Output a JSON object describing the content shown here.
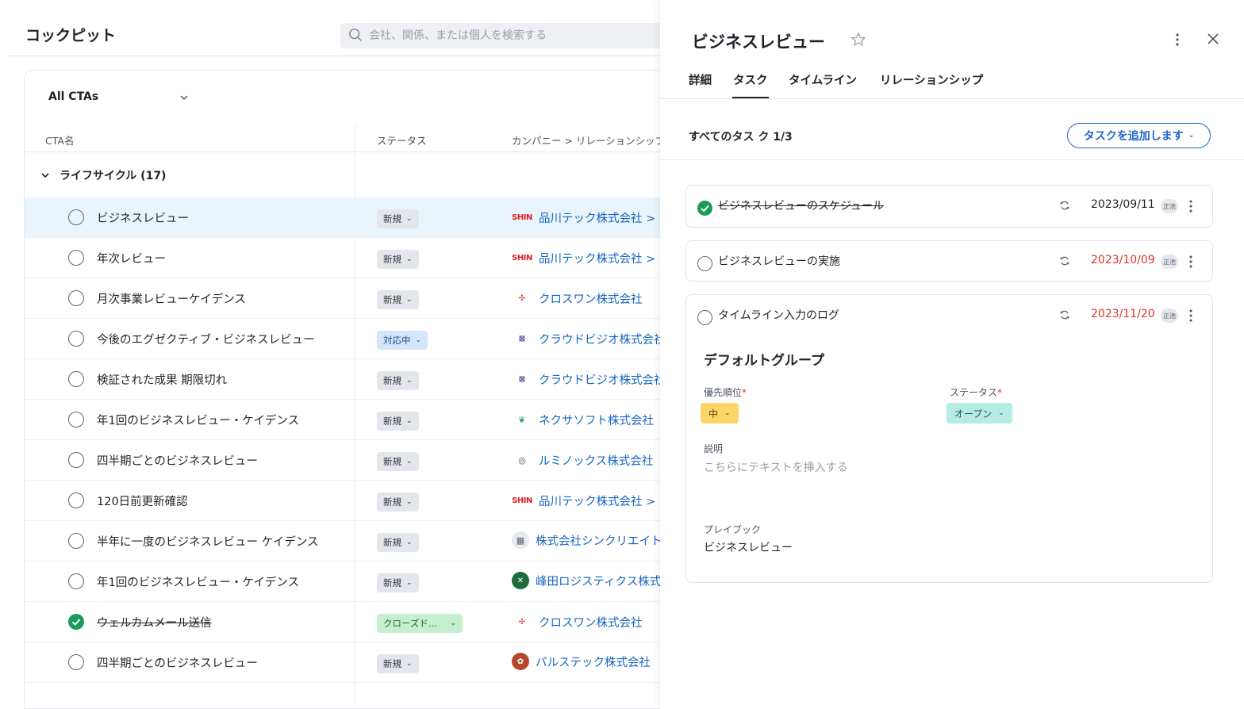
{
  "app": {
    "title": "コックピット"
  },
  "search": {
    "placeholder": "会社、関係、または個人を検索する"
  },
  "view": {
    "label": "All CTAs"
  },
  "columns": {
    "name": "CTA名",
    "status": "ステータス",
    "company": "カンパニー > リレーションシップ"
  },
  "group": {
    "label": "ライフサイクル (17)"
  },
  "rows": [
    {
      "name": "ビジネスレビュー",
      "done": false,
      "status": "新規",
      "status_kind": "new",
      "logo": "SHIN",
      "logo_kind": "shin",
      "company": "品川テック株式会社 >"
    },
    {
      "name": "年次レビュー",
      "done": false,
      "status": "新規",
      "status_kind": "new",
      "logo": "SHIN",
      "logo_kind": "shin",
      "company": "品川テック株式会社 >"
    },
    {
      "name": "月次事業レビューケイデンス",
      "done": false,
      "status": "新規",
      "status_kind": "new",
      "logo": "✣",
      "logo_kind": "cross",
      "company": "クロスワン株式会社"
    },
    {
      "name": "今後のエグゼクティブ・ビジネスレビュー",
      "done": false,
      "status": "対応中",
      "status_kind": "prog",
      "logo": "⊠",
      "logo_kind": "cloud",
      "company": "クラウドビジオ株式会社"
    },
    {
      "name": "検証された成果 期限切れ",
      "done": false,
      "status": "新規",
      "status_kind": "new",
      "logo": "⊠",
      "logo_kind": "cloud",
      "company": "クラウドビジオ株式会社"
    },
    {
      "name": "年1回のビジネスレビュー・ケイデンス",
      "done": false,
      "status": "新規",
      "status_kind": "new",
      "logo": "❦",
      "logo_kind": "nexa",
      "company": "ネクサソフト株式会社"
    },
    {
      "name": "四半期ごとのビジネスレビュー",
      "done": false,
      "status": "新規",
      "status_kind": "new",
      "logo": "◎",
      "logo_kind": "lumi",
      "company": "ルミノックス株式会社"
    },
    {
      "name": "120日前更新確認",
      "done": false,
      "status": "新規",
      "status_kind": "new",
      "logo": "SHIN",
      "logo_kind": "shin",
      "company": "品川テック株式会社 >"
    },
    {
      "name": "半年に一度のビジネスレビュー ケイデンス",
      "done": false,
      "status": "新規",
      "status_kind": "new",
      "logo": "▦",
      "logo_kind": "bldg",
      "company": "株式会社シンクリエイト"
    },
    {
      "name": "年1回のビジネスレビュー・ケイデンス",
      "done": false,
      "status": "新規",
      "status_kind": "new",
      "logo": "✕",
      "logo_kind": "mine",
      "company": "峰田ロジスティクス株式会社"
    },
    {
      "name": "ウェルカムメール送信",
      "done": true,
      "status": "クローズド...",
      "status_kind": "closed",
      "logo": "✣",
      "logo_kind": "cross",
      "company": "クロスワン株式会社"
    },
    {
      "name": "四半期ごとのビジネスレビュー",
      "done": false,
      "status": "新規",
      "status_kind": "new",
      "logo": "✿",
      "logo_kind": "puls",
      "company": "パルステック株式会社"
    }
  ],
  "panel": {
    "title": "ビジネスレビュー",
    "tabs": [
      "詳細",
      "タスク",
      "タイムライン",
      "リレーションシップ"
    ],
    "active_tab": "タスク",
    "tasks_header": "すべてのタス ク 1/3",
    "add_task_label": "タスクを追加します",
    "tasks": [
      {
        "name": "ビジネスレビューのスケジュール",
        "done": true,
        "date": "2023/09/11",
        "overdue": false,
        "owner": "正池"
      },
      {
        "name": "ビジネスレビューの実施",
        "done": false,
        "date": "2023/10/09",
        "overdue": true,
        "owner": "正池"
      },
      {
        "name": "タイムライン入力のログ",
        "done": false,
        "date": "2023/11/20",
        "overdue": true,
        "owner": "正池"
      }
    ],
    "detail": {
      "group_title": "デフォルトグループ",
      "priority_label": "優先順位",
      "priority_value": "中",
      "status_label": "ステータス",
      "status_value": "オープン",
      "description_label": "説明",
      "description_placeholder": "こちらにテキストを挿入する",
      "playbook_label": "プレイブック",
      "playbook_value": "ビジネスレビュー"
    }
  },
  "colors": {
    "accent": "#1e66c8",
    "success": "#1a9b5c",
    "overdue": "#d8352a",
    "selected_row": "#e9f4fb"
  }
}
